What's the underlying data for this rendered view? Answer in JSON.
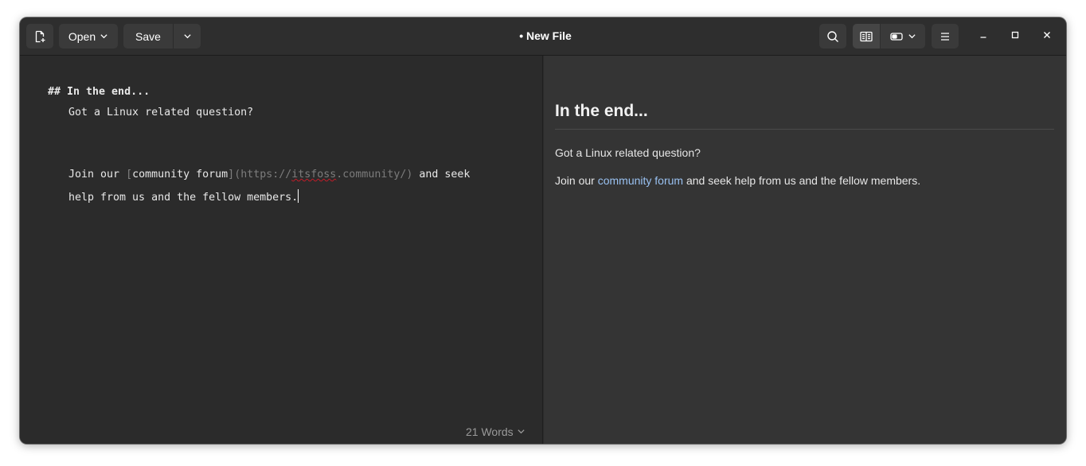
{
  "header": {
    "title": "• New File",
    "open_label": "Open",
    "save_label": "Save"
  },
  "editor": {
    "heading_line": "## In the end...",
    "line1": "Got a Linux related question?",
    "line2_pre": "Join our ",
    "line2_bracket_open": "[",
    "line2_link_text": "community forum",
    "line2_bracket_close": "]",
    "line2_paren_open": "(",
    "line2_url_a": "https://",
    "line2_url_b": "itsfoss",
    "line2_url_c": ".community/",
    "line2_paren_close": ")",
    "line2_post": " and seek",
    "line3": "help from us and the fellow members.",
    "word_count": "21 Words"
  },
  "preview": {
    "heading": "In the end...",
    "para1": "Got a Linux related question?",
    "para2_pre": "Join our ",
    "para2_link": "community forum",
    "para2_post": " and seek help from us and the fellow members."
  },
  "icons": {
    "new_file": "new-file-icon",
    "open_chevron": "chevron-down-icon",
    "save_menu": "chevron-down-icon",
    "search": "search-icon",
    "sidebar_view": "book-icon",
    "preview_layout": "toggle-icon",
    "menu": "hamburger-icon",
    "minimize": "minimize-icon",
    "maximize": "maximize-icon",
    "close": "close-icon"
  },
  "colors": {
    "background": "#2b2b2b",
    "preview_background": "#343434",
    "headerbar": "#2e2e2e",
    "button": "#3a3a3a",
    "link": "#99c1f1",
    "spell_underline": "#c01c28"
  }
}
